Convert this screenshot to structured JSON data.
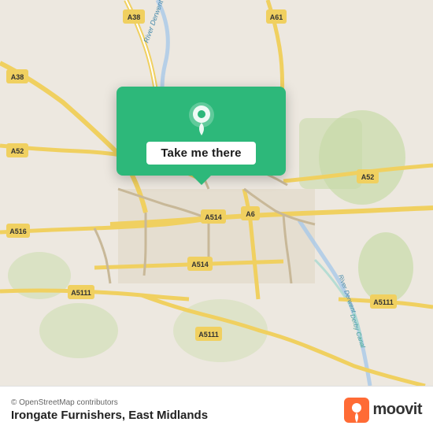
{
  "map": {
    "background_color": "#ede8e0",
    "center_lat": 52.917,
    "center_lon": -1.478
  },
  "popup": {
    "button_label": "Take me there",
    "background_color": "#2db87a"
  },
  "bottom_bar": {
    "osm_credit": "© OpenStreetMap contributors",
    "location_name": "Irongate Furnishers, East Midlands",
    "moovit_label": "moovit"
  },
  "road_labels": {
    "a38_top": "A38",
    "a38_left": "A38",
    "a52_left": "A52",
    "a516": "A516",
    "a5111_bottom_left": "A5111",
    "a5111_bottom_mid": "A5111",
    "a5111_bottom_right": "A5111",
    "a514_mid": "A514",
    "a514_bottom": "A514",
    "a6": "A6",
    "a52_right": "A52",
    "a61": "A61",
    "river_derwent_top": "River Derwent",
    "river_derwent_right": "River Derwent",
    "derby_canal": "Derby Canal"
  }
}
